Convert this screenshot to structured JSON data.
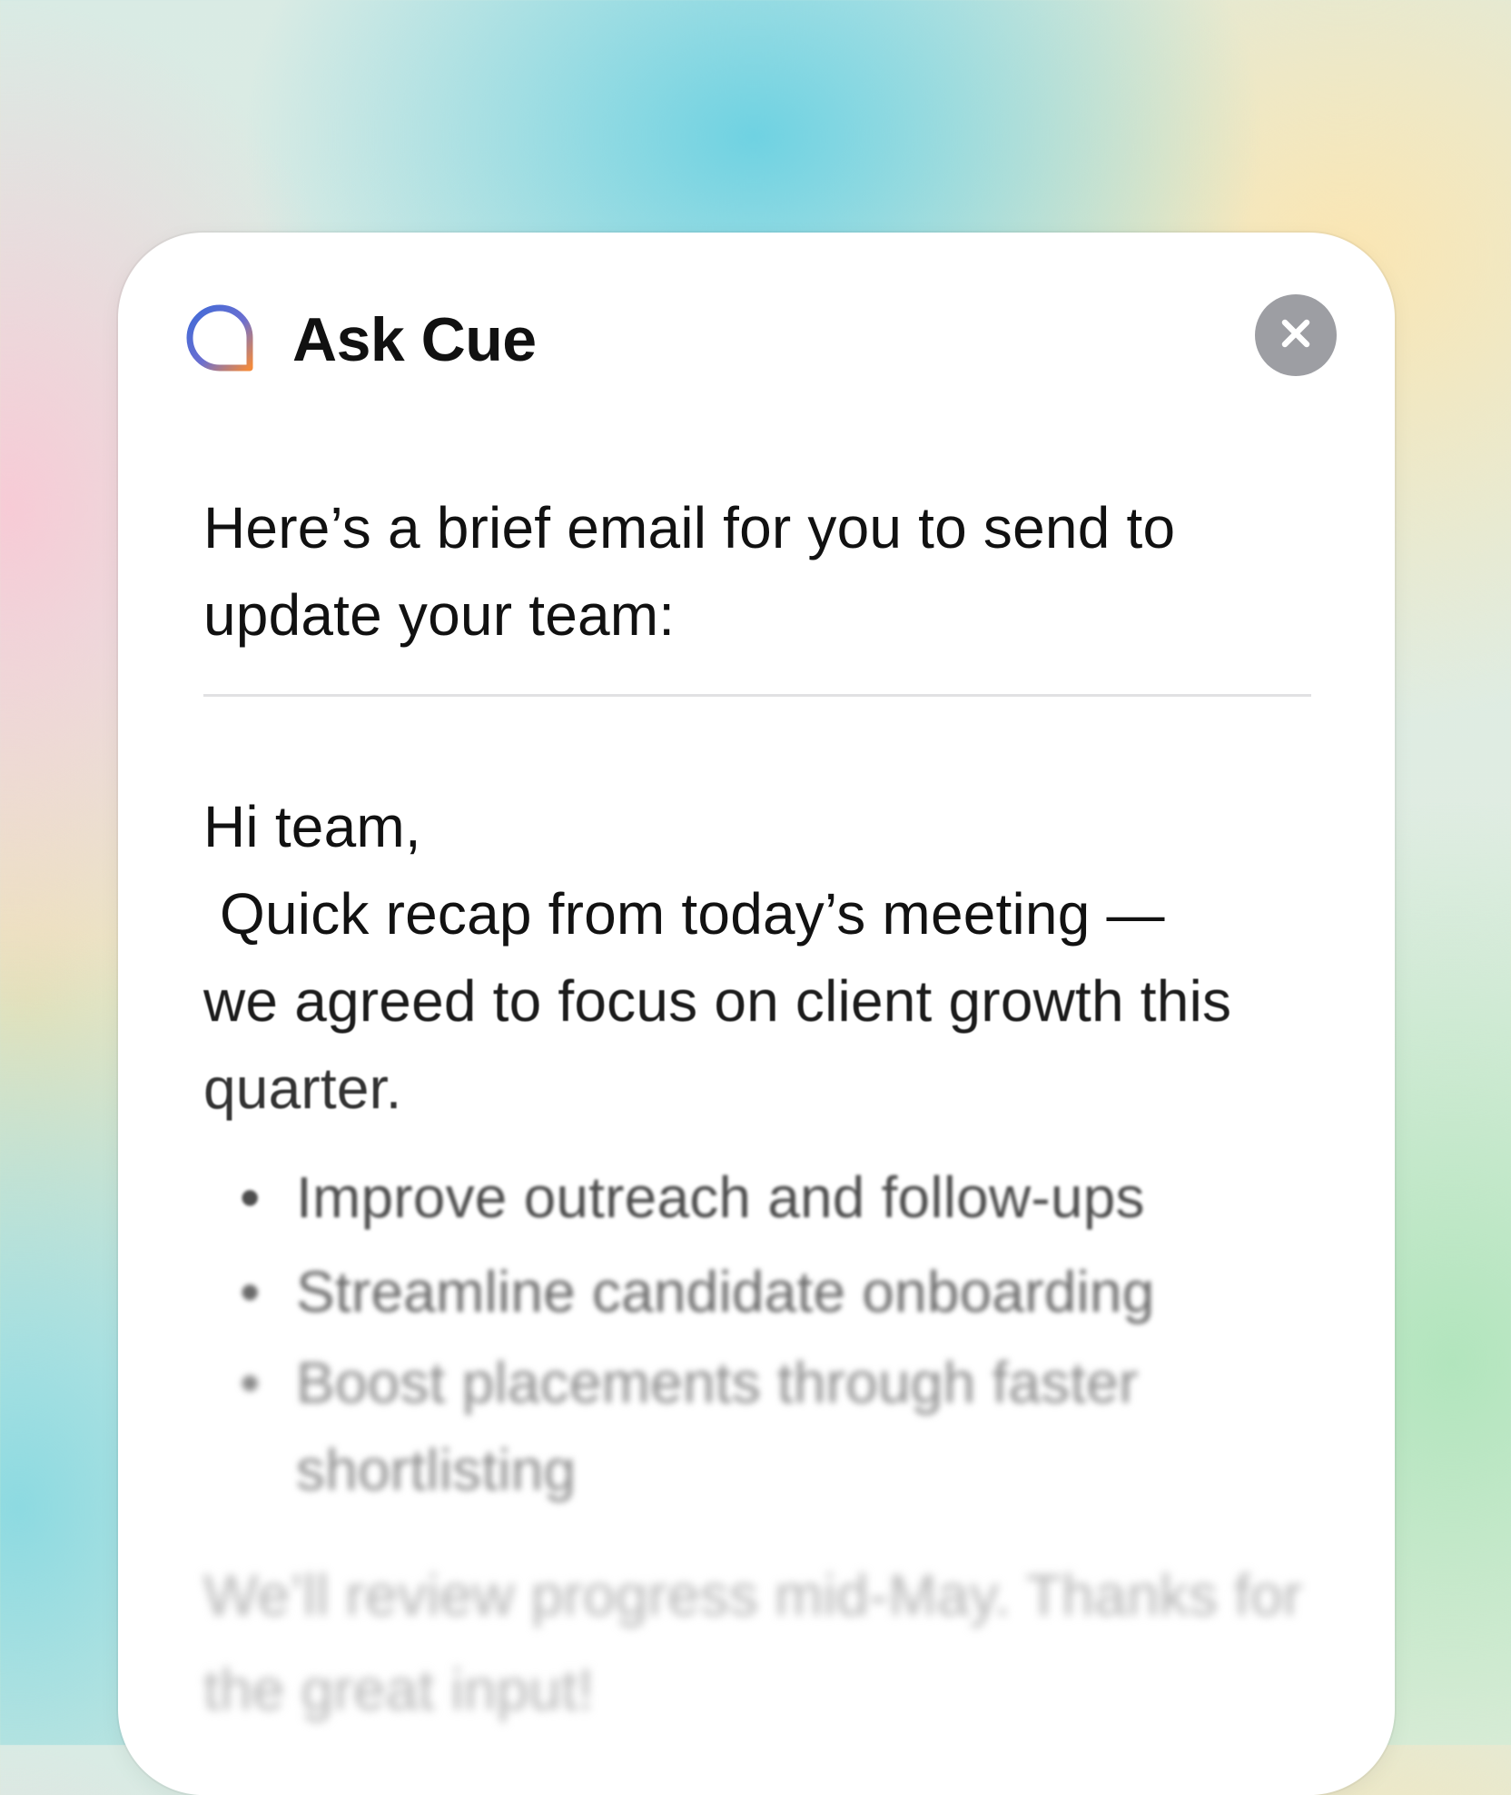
{
  "window": {
    "title": "Ask Cue",
    "logo_icon": "cue-chat-bubble-icon",
    "close_icon": "close-icon",
    "accent_colors": [
      "#3f6ad8",
      "#f08040"
    ],
    "close_button_color": "#9d9ea3"
  },
  "response": {
    "intro": "Here’s a brief email for you to send to update your team:",
    "email": {
      "greeting": "Hi team,",
      "recap": "Quick recap from today’s meeting —",
      "agreement": "we agreed to focus on client growth this",
      "agreement_end": "quarter.",
      "bullets": [
        "Improve outreach and follow-ups",
        "Streamline candidate onboarding",
        "Boost placements through faster shortlisting"
      ],
      "closing": "We’ll review progress mid-May. Thanks for the great input!"
    }
  }
}
